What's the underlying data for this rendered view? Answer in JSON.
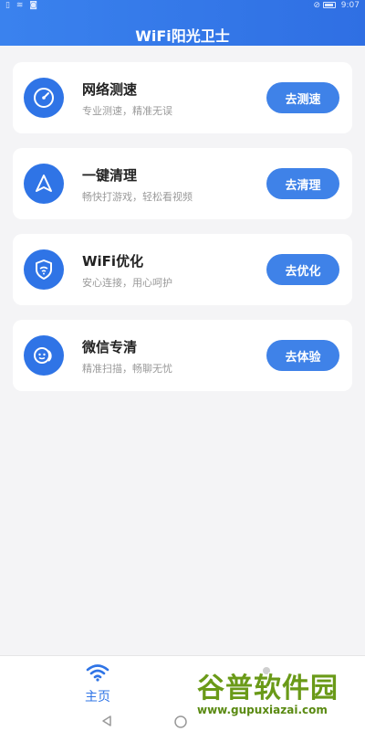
{
  "status_bar": {
    "time": "9:07"
  },
  "header": {
    "title": "WiFi阳光卫士"
  },
  "features": [
    {
      "title": "网络测速",
      "subtitle": "专业测速，精准无误",
      "button": "去测速",
      "icon": "speedometer-icon"
    },
    {
      "title": "一键清理",
      "subtitle": "畅快打游戏，轻松看视频",
      "button": "去清理",
      "icon": "navigation-arrow-icon"
    },
    {
      "title": "WiFi优化",
      "subtitle": "安心连接，用心呵护",
      "button": "去优化",
      "icon": "shield-wifi-icon"
    },
    {
      "title": "微信专清",
      "subtitle": "精准扫描，畅聊无忧",
      "button": "去体验",
      "icon": "chat-bubble-icon"
    }
  ],
  "tabbar": {
    "home_label": "主页"
  },
  "watermark": {
    "line1": "谷普软件园",
    "line2": "www.gupuxiazai.com"
  },
  "colors": {
    "primary": "#2f74e6",
    "button": "#3f82e8",
    "background": "#f4f4f6"
  }
}
